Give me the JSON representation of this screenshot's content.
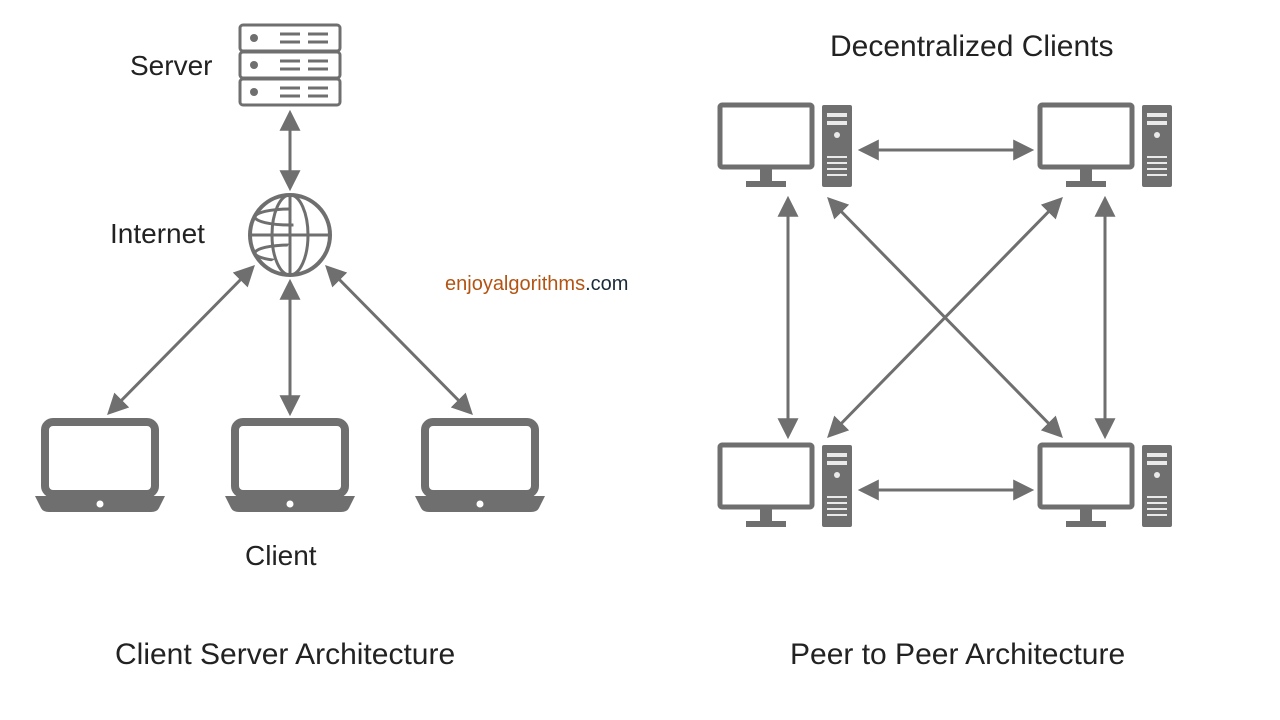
{
  "left": {
    "server_label": "Server",
    "internet_label": "Internet",
    "client_label": "Client",
    "title": "Client Server Architecture"
  },
  "right": {
    "header": "Decentralized Clients",
    "title": "Peer to Peer Architecture"
  },
  "brand": {
    "name": "enjoyalgorithms",
    "suffix": ".com"
  },
  "colors": {
    "stroke": "#6f6f6f",
    "text": "#222222",
    "brand_name": "#b35413",
    "brand_suffix": "#1a2a3a"
  },
  "diagram": {
    "type": "network-architecture",
    "panels": [
      {
        "name": "client-server",
        "nodes": [
          "server",
          "internet",
          "client-1",
          "client-2",
          "client-3"
        ],
        "edges": [
          [
            "server",
            "internet"
          ],
          [
            "internet",
            "client-1"
          ],
          [
            "internet",
            "client-2"
          ],
          [
            "internet",
            "client-3"
          ]
        ]
      },
      {
        "name": "peer-to-peer",
        "nodes": [
          "peer-top-left",
          "peer-top-right",
          "peer-bottom-left",
          "peer-bottom-right"
        ],
        "edges": [
          [
            "peer-top-left",
            "peer-top-right"
          ],
          [
            "peer-bottom-left",
            "peer-bottom-right"
          ],
          [
            "peer-top-left",
            "peer-bottom-left"
          ],
          [
            "peer-top-right",
            "peer-bottom-right"
          ],
          [
            "peer-top-left",
            "peer-bottom-right"
          ],
          [
            "peer-top-right",
            "peer-bottom-left"
          ]
        ]
      }
    ]
  }
}
